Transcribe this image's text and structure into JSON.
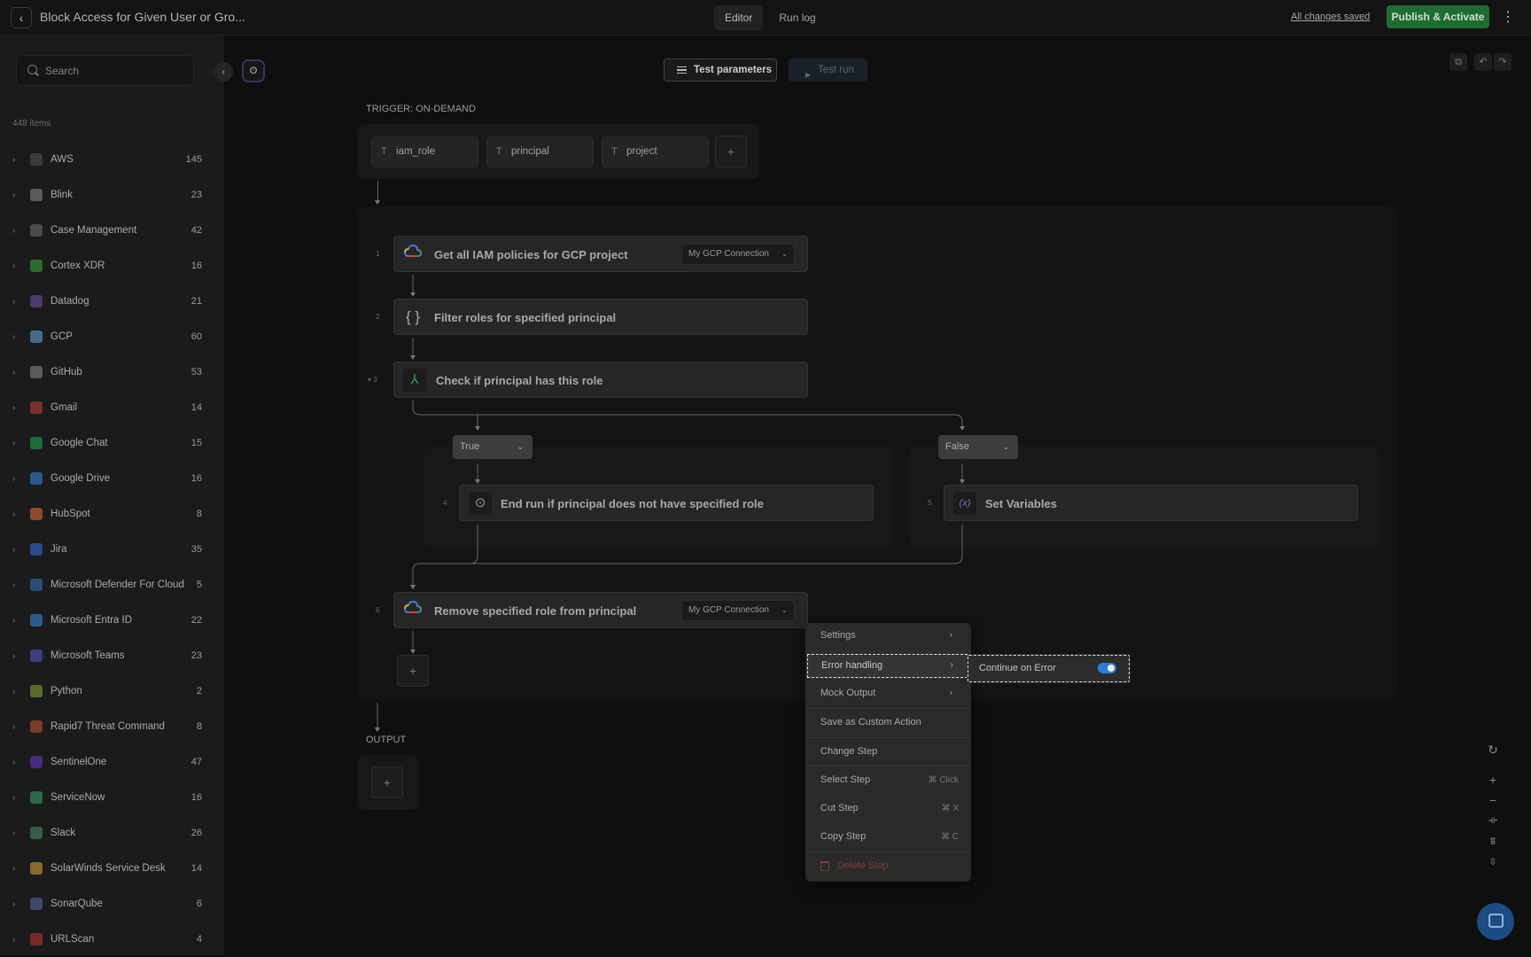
{
  "header": {
    "title": "Block Access for Given User or Gro...",
    "tabs": [
      {
        "label": "Editor",
        "active": true
      },
      {
        "label": "Run log",
        "active": false
      }
    ],
    "save_status": "All changes saved",
    "publish_label": "Publish & Activate",
    "publish_color": "#1e6c31"
  },
  "sidebar": {
    "search_placeholder": "Search",
    "items_count": "448 items",
    "integrations": [
      {
        "name": "AWS",
        "count": "145",
        "icon_color": "#3a3a3a"
      },
      {
        "name": "Blink",
        "count": "23",
        "icon_color": "#5a5a5a"
      },
      {
        "name": "Case Management",
        "count": "42",
        "icon_color": "#4a4a4a"
      },
      {
        "name": "Cortex XDR",
        "count": "16",
        "icon_color": "#2d6b2d"
      },
      {
        "name": "Datadog",
        "count": "21",
        "icon_color": "#4b3a6b"
      },
      {
        "name": "GCP",
        "count": "60",
        "icon_color": "#4a6a8a"
      },
      {
        "name": "GitHub",
        "count": "53",
        "icon_color": "#5a5a5a"
      },
      {
        "name": "Gmail",
        "count": "14",
        "icon_color": "#7a2e2e"
      },
      {
        "name": "Google Chat",
        "count": "15",
        "icon_color": "#1e6b3a"
      },
      {
        "name": "Google Drive",
        "count": "16",
        "icon_color": "#2a5a8a"
      },
      {
        "name": "HubSpot",
        "count": "8",
        "icon_color": "#8a4a2a"
      },
      {
        "name": "Jira",
        "count": "35",
        "icon_color": "#2a4a8a"
      },
      {
        "name": "Microsoft Defender For Cloud",
        "count": "5",
        "icon_color": "#2a4a7a"
      },
      {
        "name": "Microsoft Entra ID",
        "count": "22",
        "icon_color": "#2a5a8a"
      },
      {
        "name": "Microsoft Teams",
        "count": "23",
        "icon_color": "#3d3d7a"
      },
      {
        "name": "Python",
        "count": "2",
        "icon_color": "#5a6a2a"
      },
      {
        "name": "Rapid7 Threat Command",
        "count": "8",
        "icon_color": "#7a3a2a"
      },
      {
        "name": "SentinelOne",
        "count": "47",
        "icon_color": "#4a2a7a"
      },
      {
        "name": "ServiceNow",
        "count": "16",
        "icon_color": "#2a6a4a"
      },
      {
        "name": "Slack",
        "count": "26",
        "icon_color": "#3a5a4a"
      },
      {
        "name": "SolarWinds Service Desk",
        "count": "14",
        "icon_color": "#8a6a2a"
      },
      {
        "name": "SonarQube",
        "count": "6",
        "icon_color": "#3a4a6a"
      },
      {
        "name": "URLScan",
        "count": "4",
        "icon_color": "#7a2a2a"
      }
    ]
  },
  "toolbar": {
    "test_params_label": "Test parameters",
    "test_run_label": "Test run"
  },
  "trigger": {
    "label": "TRIGGER: ON-DEMAND",
    "params": [
      "iam_role",
      "principal",
      "project"
    ],
    "add_label": "+"
  },
  "steps": [
    {
      "num": "1",
      "title": "Get all IAM policies for GCP project",
      "connection": "My GCP Connection",
      "icon": "gcp-icon"
    },
    {
      "num": "2",
      "title": "Filter roles for specified principal",
      "icon": "braces-icon"
    },
    {
      "num": "3",
      "title": "Check if principal has this role",
      "icon": "branch-icon"
    },
    {
      "num": "4",
      "title": "End run if principal does not have specified role",
      "icon": "stop-icon"
    },
    {
      "num": "5",
      "title": "Set Variables",
      "icon": "variable-icon"
    },
    {
      "num": "6",
      "title": "Remove specified role from principal",
      "connection": "My GCP Connection",
      "icon": "gcp-icon"
    }
  ],
  "branches": {
    "true_label": "True",
    "false_label": "False"
  },
  "output": {
    "label": "OUTPUT",
    "add_label": "+"
  },
  "context_menu": {
    "items": [
      {
        "label": "Settings",
        "submenu": true
      },
      {
        "label": "Error handling",
        "submenu": true,
        "highlighted": true
      },
      {
        "label": "Mock Output",
        "submenu": true
      },
      {
        "label": "Save as Custom Action"
      },
      {
        "label": "Change Step"
      },
      {
        "label": "Select Step",
        "shortcut": "⌘ Click"
      },
      {
        "label": "Cut Step",
        "shortcut": "⌘ X"
      },
      {
        "label": "Copy Step",
        "shortcut": "⌘ C"
      },
      {
        "label": "Delete Step",
        "danger": true
      }
    ],
    "submenu": {
      "label": "Continue on Error",
      "toggle_on": true,
      "toggle_color": "#2d7dd6"
    }
  }
}
